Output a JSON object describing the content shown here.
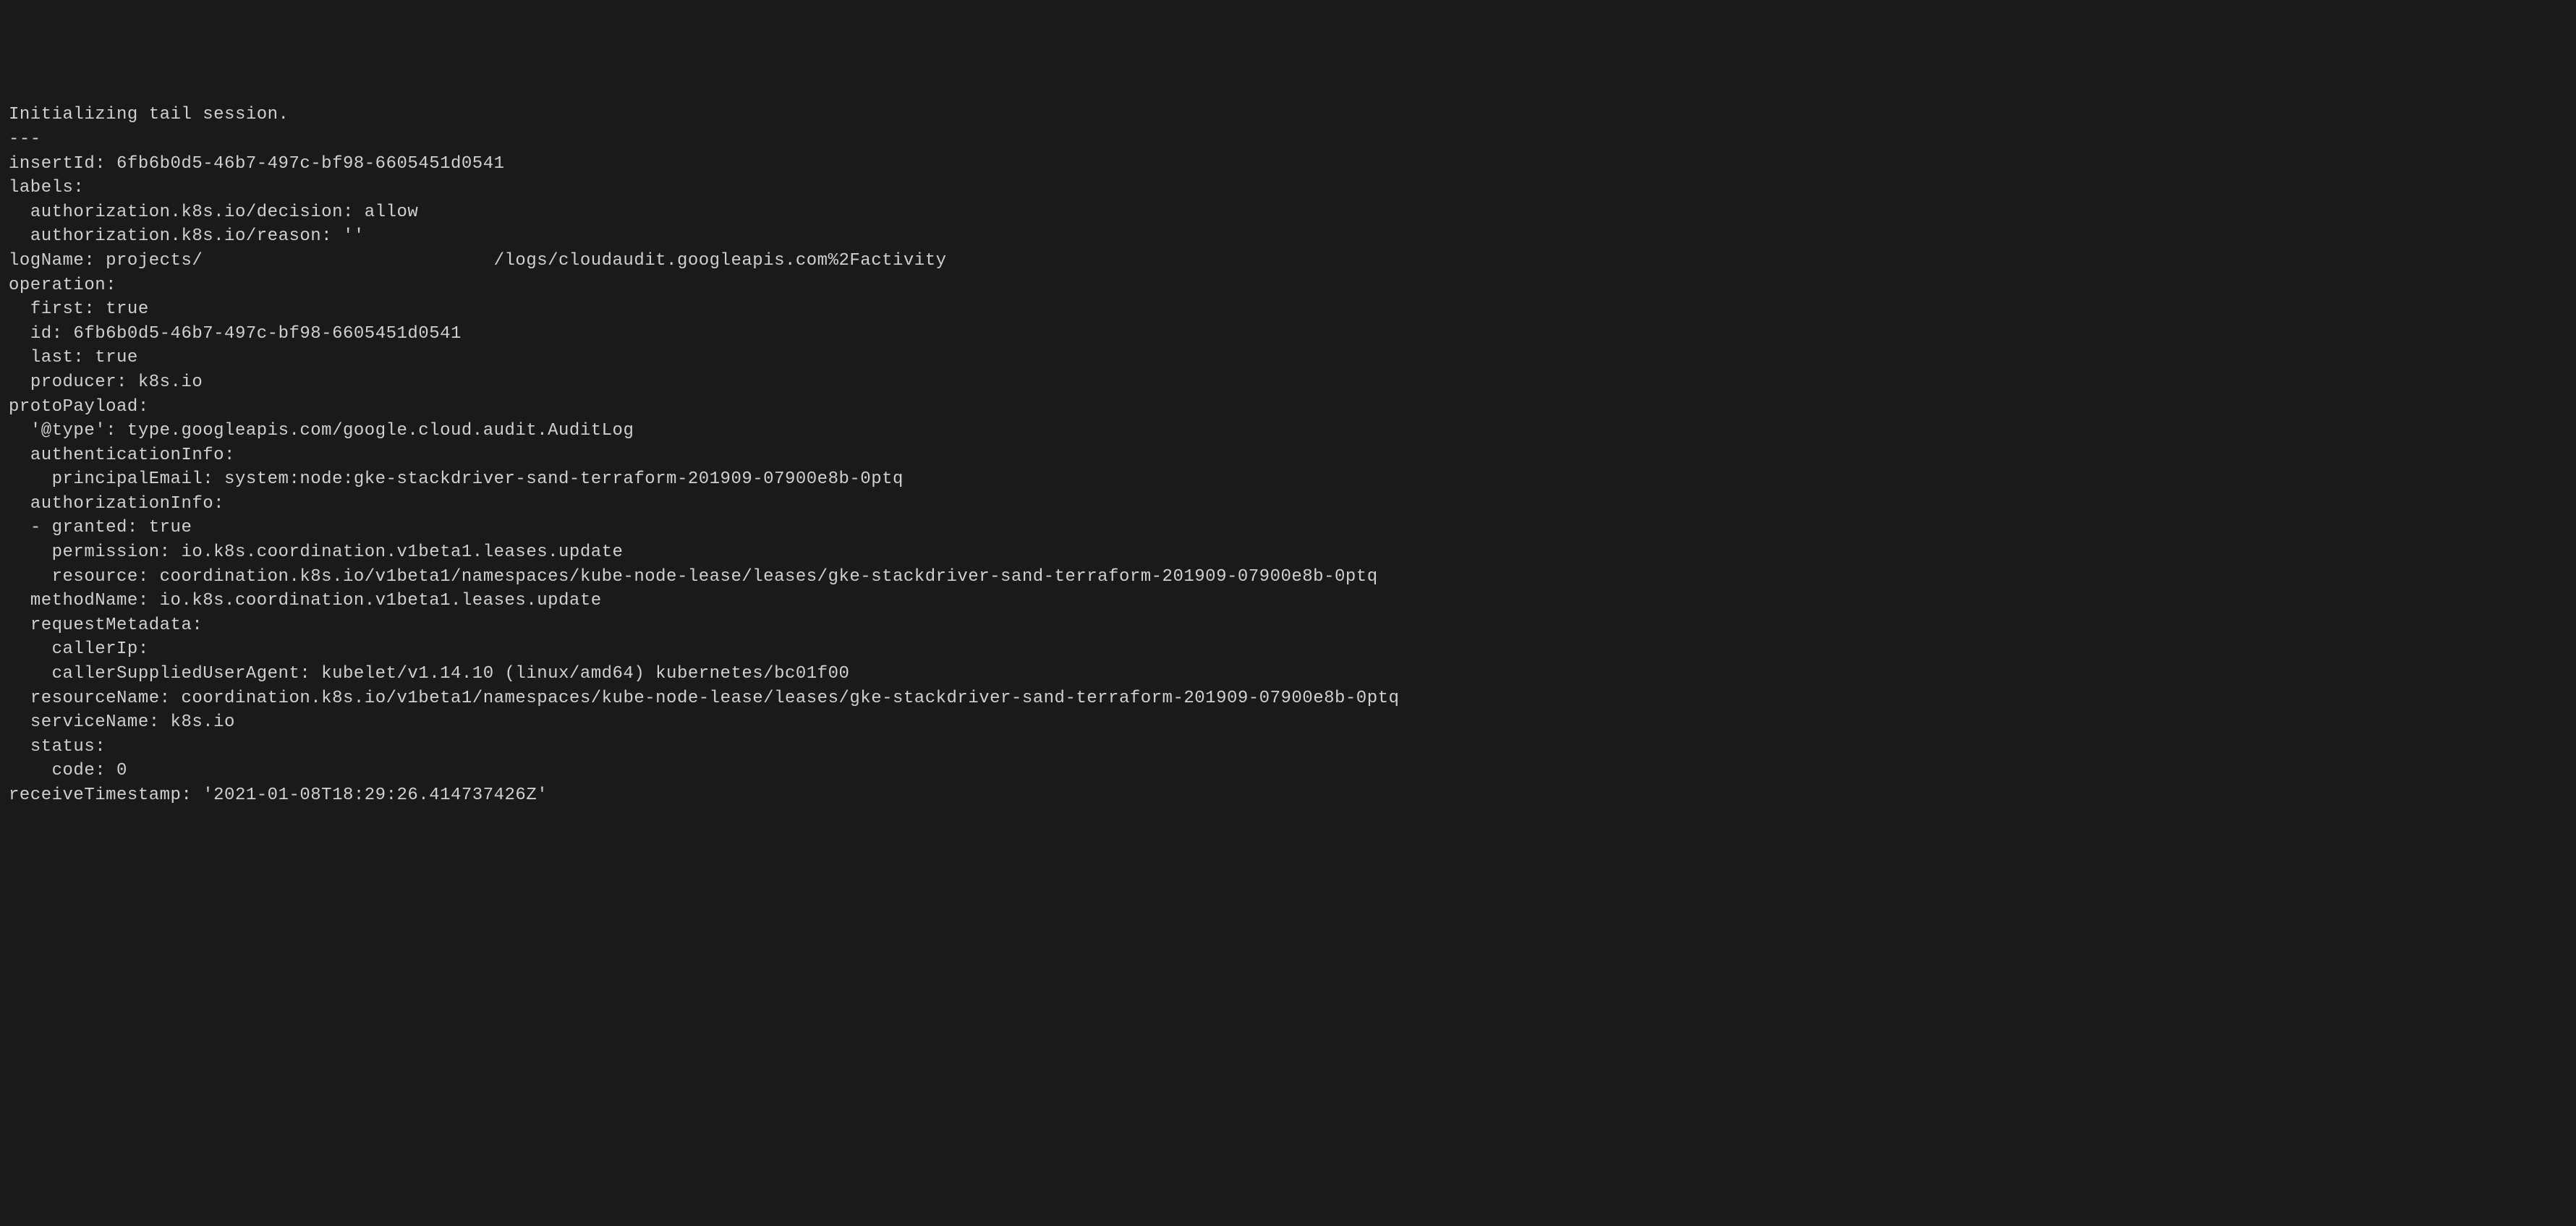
{
  "terminal": {
    "lines": [
      "Initializing tail session.",
      "---",
      "insertId: 6fb6b0d5-46b7-497c-bf98-6605451d0541",
      "labels:",
      "  authorization.k8s.io/decision: allow",
      "  authorization.k8s.io/reason: ''",
      "logName: projects/                           /logs/cloudaudit.googleapis.com%2Factivity",
      "operation:",
      "  first: true",
      "  id: 6fb6b0d5-46b7-497c-bf98-6605451d0541",
      "  last: true",
      "  producer: k8s.io",
      "protoPayload:",
      "  '@type': type.googleapis.com/google.cloud.audit.AuditLog",
      "  authenticationInfo:",
      "    principalEmail: system:node:gke-stackdriver-sand-terraform-201909-07900e8b-0ptq",
      "  authorizationInfo:",
      "  - granted: true",
      "    permission: io.k8s.coordination.v1beta1.leases.update",
      "    resource: coordination.k8s.io/v1beta1/namespaces/kube-node-lease/leases/gke-stackdriver-sand-terraform-201909-07900e8b-0ptq",
      "  methodName: io.k8s.coordination.v1beta1.leases.update",
      "  requestMetadata:",
      "    callerIp:",
      "    callerSuppliedUserAgent: kubelet/v1.14.10 (linux/amd64) kubernetes/bc01f00",
      "  resourceName: coordination.k8s.io/v1beta1/namespaces/kube-node-lease/leases/gke-stackdriver-sand-terraform-201909-07900e8b-0ptq",
      "  serviceName: k8s.io",
      "  status:",
      "    code: 0",
      "receiveTimestamp: '2021-01-08T18:29:26.414737426Z'"
    ]
  }
}
